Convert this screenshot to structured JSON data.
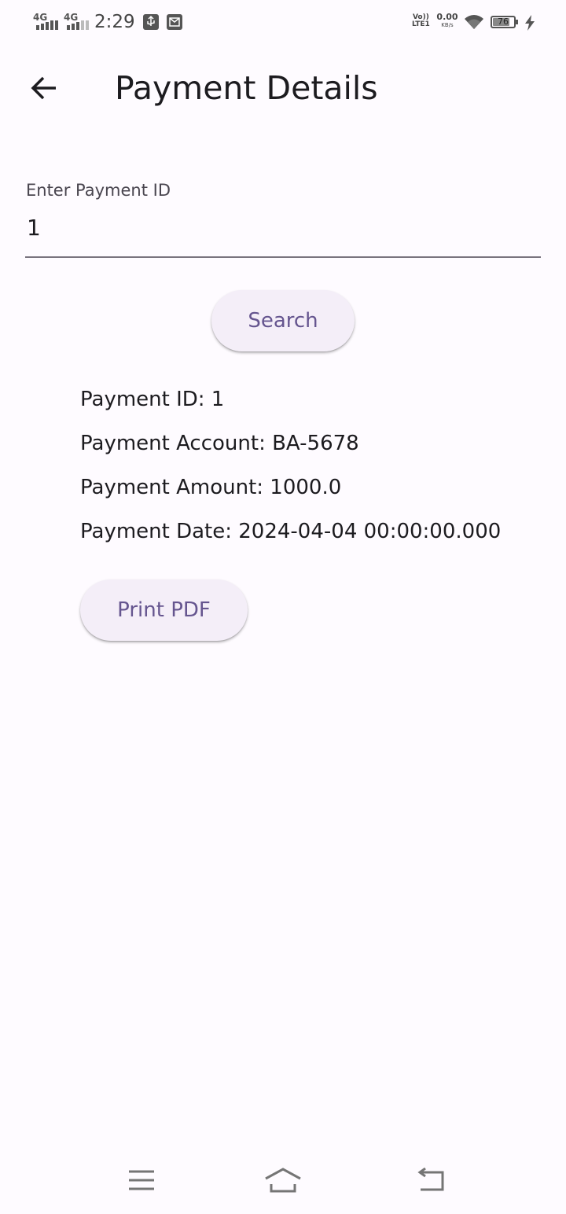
{
  "status_bar": {
    "network_1": "4G",
    "network_2": "4G",
    "time": "2:29",
    "volte_top": "Vo))",
    "volte_bottom": "LTE1",
    "speed_value": "0.00",
    "speed_unit": "KB/s",
    "battery_level": "76",
    "icons": [
      "usb-debug-icon",
      "mail-notification-icon",
      "wifi-icon",
      "battery-icon",
      "charging-bolt-icon"
    ]
  },
  "app_bar": {
    "title": "Payment Details",
    "back_icon": "arrow-back-icon"
  },
  "search_form": {
    "label": "Enter Payment ID",
    "value": "1",
    "search_label": "Search"
  },
  "payment": {
    "id_line": "Payment ID: 1",
    "account_line": "Payment Account: BA-5678",
    "amount_line": "Payment Amount: 1000.0",
    "date_line": "Payment Date: 2024-04-04 00:00:00.000"
  },
  "actions": {
    "print_label": "Print PDF"
  },
  "nav_bar": {
    "icons": [
      "menu-icon",
      "home-icon",
      "back-icon"
    ]
  },
  "colors": {
    "background": "#fefbff",
    "accent": "#65558f",
    "button_surface": "#f4eef8",
    "text": "#1c1b1f"
  }
}
